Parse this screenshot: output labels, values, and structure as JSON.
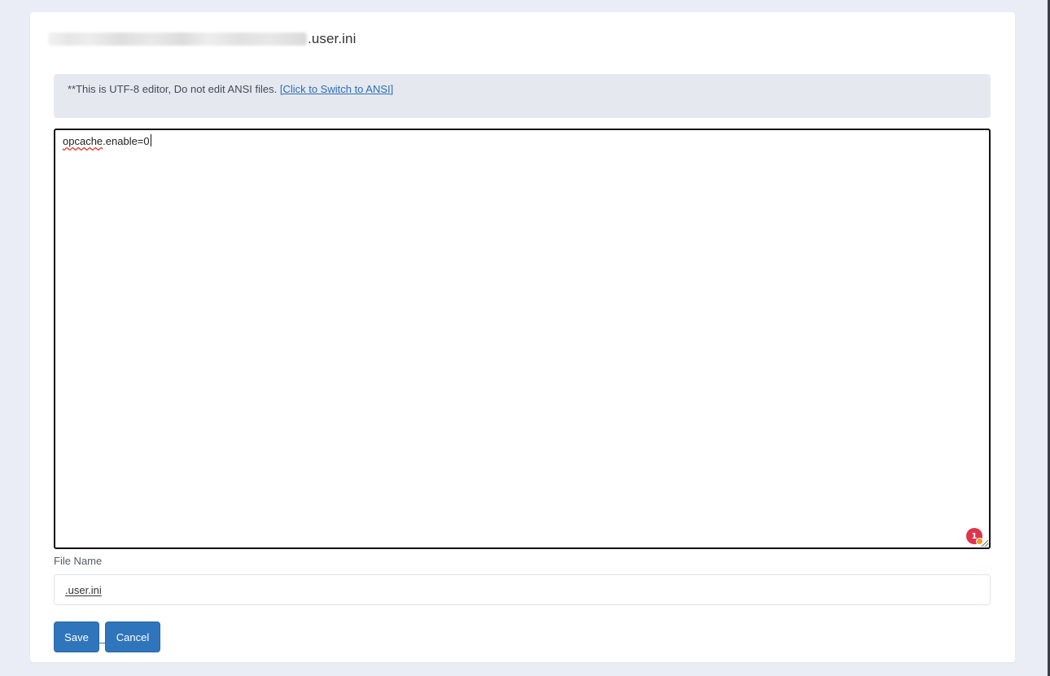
{
  "header": {
    "title_suffix": ".user.ini"
  },
  "notice": {
    "text": "**This is UTF-8 editor, Do not edit ANSI files. ",
    "link_label": "[Click to Switch to ANSI]"
  },
  "editor": {
    "misspelled_word": "opcache",
    "rest_of_line": ".enable=0",
    "extension_badge_count": "1"
  },
  "form": {
    "file_name_label": "File Name",
    "file_name_value": ".user.ini"
  },
  "actions": {
    "save_label": "Save",
    "cancel_label": "Cancel"
  },
  "colors": {
    "primary_button": "#2f75bb",
    "notice_background": "#e5e9ef",
    "page_background": "#eaedf5",
    "badge": "#e0334e"
  }
}
